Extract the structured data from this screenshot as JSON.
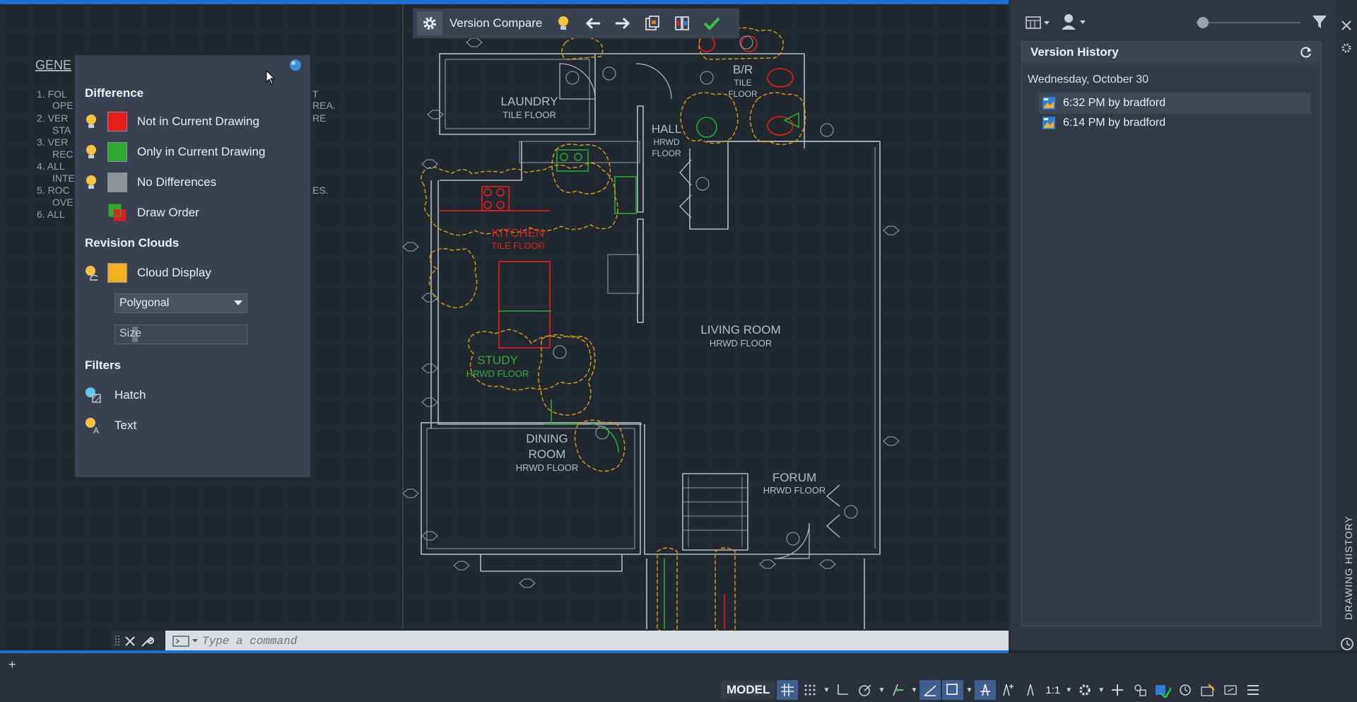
{
  "toolbar": {
    "title": "Version Compare"
  },
  "compare_panel": {
    "difference_title": "Difference",
    "items": [
      {
        "label": "Not in Current Drawing",
        "color": "#e81c1c"
      },
      {
        "label": "Only in Current Drawing",
        "color": "#2fa82f"
      },
      {
        "label": "No Differences",
        "color": "#8f9296"
      },
      {
        "label": "Draw Order"
      }
    ],
    "revision_clouds_title": "Revision Clouds",
    "cloud_display_label": "Cloud Display",
    "cloud_color": "#f2b01e",
    "cloud_shape": "Polygonal",
    "cloud_size_label": "Size",
    "filters_title": "Filters",
    "filter_hatch": "Hatch",
    "filter_text": "Text"
  },
  "notes": {
    "heading": "GENE",
    "lines": [
      "1.  FOL",
      "OPE",
      "2.  VER",
      "STA",
      "3.  VER",
      "REC",
      "4.  ALL",
      "INTE",
      "5.  ROC",
      "OVE",
      "6.  ALL"
    ],
    "right_fragments": [
      "T",
      "REA.",
      "RE",
      "ES."
    ]
  },
  "rooms": {
    "laundry": {
      "name": "LAUNDRY",
      "floor": "TILE FLOOR"
    },
    "br": {
      "name": "B/R",
      "floor1": "TILE",
      "floor2": "FLOOR"
    },
    "hall": {
      "name": "HALL",
      "floor1": "HRWD",
      "floor2": "FLOOR"
    },
    "kitchen": {
      "name": "KITCHEN",
      "floor": "TILE FLOOR"
    },
    "study": {
      "name": "STUDY",
      "floor": "HRWD FLOOR"
    },
    "living": {
      "name": "LIVING ROOM",
      "floor": "HRWD FLOOR"
    },
    "dining": {
      "name1": "DINING",
      "name2": "ROOM",
      "floor": "HRWD FLOOR"
    },
    "forum": {
      "name": "FORUM",
      "floor": "HRWD FLOOR"
    }
  },
  "version_history": {
    "title": "Version History",
    "date": "Wednesday, October 30",
    "versions": [
      {
        "label": "6:32 PM by bradford",
        "selected": true
      },
      {
        "label": "6:14 PM by bradford",
        "selected": false
      }
    ],
    "side_tab": "DRAWING HISTORY"
  },
  "command_line": {
    "placeholder": "Type a command"
  },
  "status_bar": {
    "model_label": "MODEL",
    "scale": "1:1"
  },
  "colors": {
    "accent_blue": "#1e6fd6",
    "canvas_bg": "#212830",
    "panel_bg": "#3a4252"
  }
}
